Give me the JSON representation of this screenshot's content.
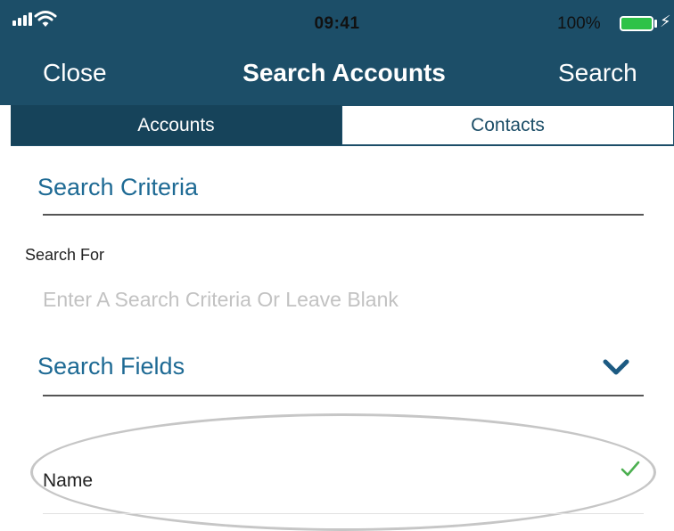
{
  "status_bar": {
    "time": "09:41",
    "battery_percent": "100%",
    "battery_level": 1.0,
    "signal_bars": 4,
    "icons": [
      "signal-icon",
      "wifi-icon",
      "battery-icon",
      "charging-bolt-icon"
    ]
  },
  "nav": {
    "close_label": "Close",
    "title": "Search Accounts",
    "search_label": "Search"
  },
  "tabs": [
    {
      "label": "Accounts",
      "selected": true
    },
    {
      "label": "Contacts",
      "selected": false
    }
  ],
  "search_criteria": {
    "heading": "Search Criteria",
    "search_for_label": "Search For",
    "input_value": "",
    "input_placeholder": "Enter A Search Criteria Or Leave Blank"
  },
  "search_fields": {
    "heading": "Search Fields",
    "expand_icon": "chevron-down-icon",
    "items": [
      {
        "label": "Name",
        "checked": true,
        "icon": "checkmark-icon"
      }
    ]
  },
  "colors": {
    "nav_background": "#1c4e68",
    "segment_active": "#16435a",
    "heading_blue": "#1e6a94",
    "check_green": "#4caf50",
    "battery_green": "#2ec248",
    "placeholder_gray": "#c2c2c2"
  }
}
